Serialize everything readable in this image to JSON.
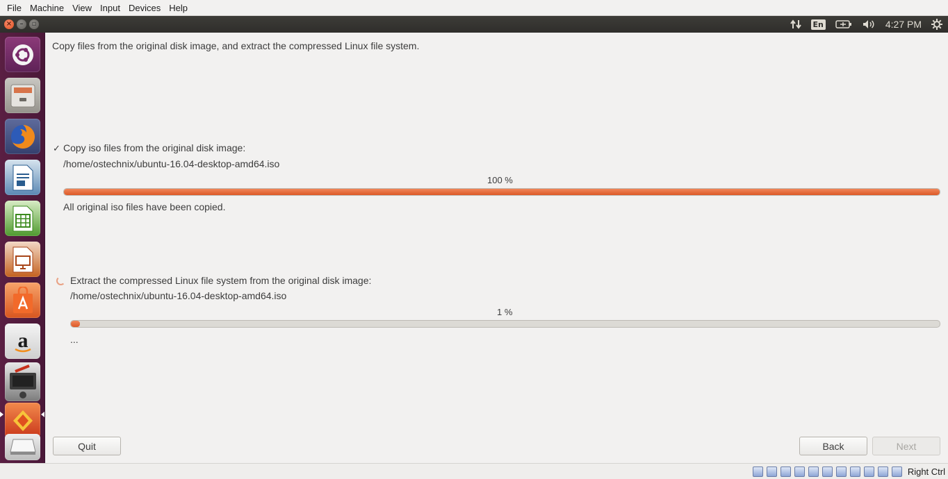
{
  "host_menu": [
    "File",
    "Machine",
    "View",
    "Input",
    "Devices",
    "Help"
  ],
  "top_panel": {
    "window_controls": [
      "close-icon",
      "minimize-icon",
      "maximize-icon"
    ],
    "indicators": {
      "network_icon": "network-updown-icon",
      "keyboard_layout": "En",
      "battery_icon": "battery-icon",
      "volume_icon": "volume-icon",
      "clock": "4:27 PM",
      "session_icon": "gear-icon"
    }
  },
  "launcher": {
    "items": [
      {
        "name": "ubuntu-dash-icon"
      },
      {
        "name": "files-icon"
      },
      {
        "name": "firefox-icon"
      },
      {
        "name": "libreoffice-writer-icon"
      },
      {
        "name": "libreoffice-calc-icon"
      },
      {
        "name": "libreoffice-impress-icon"
      },
      {
        "name": "ubuntu-software-icon"
      },
      {
        "name": "amazon-icon"
      },
      {
        "name": "installer-icon"
      },
      {
        "name": "system-settings-icon"
      },
      {
        "name": "drive-icon"
      }
    ]
  },
  "installer": {
    "description": "Copy files from the original disk image, and extract the compressed Linux file system.",
    "task1": {
      "check": "✓",
      "title": "Copy iso files from the original disk image:",
      "path": "/home/ostechnix/ubuntu-16.04-desktop-amd64.iso",
      "percent_label": "100 %",
      "progress": 1.0,
      "status": "All original iso files have been copied."
    },
    "task2": {
      "title": "Extract the compressed Linux file system from the original disk image:",
      "path": "/home/ostechnix/ubuntu-16.04-desktop-amd64.iso",
      "percent_label": "1 %",
      "progress": 0.01,
      "status": "..."
    },
    "buttons": {
      "quit": "Quit",
      "back": "Back",
      "next": "Next"
    }
  },
  "statusbar": {
    "host_key": "Right Ctrl"
  },
  "colors": {
    "accent": "#dd5a27",
    "launcher_bg": "#4a1838",
    "panel_bg": "#2f2e2b"
  }
}
